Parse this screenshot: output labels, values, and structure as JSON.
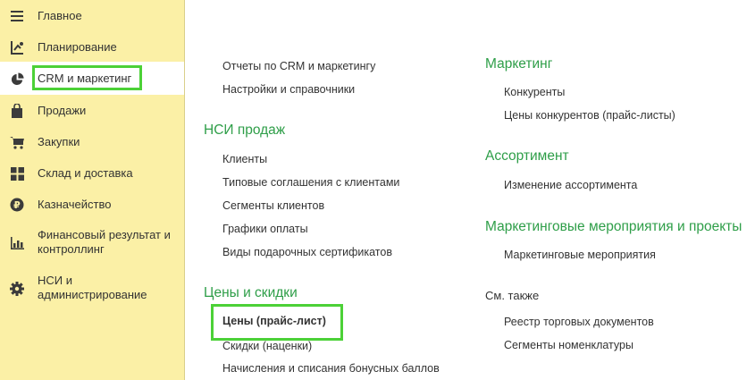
{
  "sidebar": {
    "items": [
      {
        "label": "Главное",
        "icon": "menu-icon"
      },
      {
        "label": "Планирование",
        "icon": "planning-icon"
      },
      {
        "label": "CRM и маркетинг",
        "icon": "pie-chart-icon"
      },
      {
        "label": "Продажи",
        "icon": "shopping-bag-icon"
      },
      {
        "label": "Закупки",
        "icon": "cart-icon"
      },
      {
        "label": "Склад и доставка",
        "icon": "warehouse-icon"
      },
      {
        "label": "Казначейство",
        "icon": "ruble-icon"
      },
      {
        "label": "Финансовый результат и",
        "label2": "контроллинг",
        "icon": "bar-chart-icon"
      },
      {
        "label": "НСИ и",
        "label2": "администрирование",
        "icon": "gear-icon"
      }
    ]
  },
  "left_column": {
    "top_links": [
      "Отчеты по CRM и маркетингу",
      "Настройки и справочники"
    ],
    "sections": [
      {
        "title": "НСИ продаж",
        "links": [
          "Клиенты",
          "Типовые соглашения с клиентами",
          "Сегменты клиентов",
          "Графики оплаты",
          "Виды подарочных сертификатов"
        ]
      },
      {
        "title": "Цены и скидки",
        "links": [
          "Цены (прайс-лист)",
          "Скидки (наценки)",
          "Начисления и списания бонусных баллов"
        ]
      }
    ]
  },
  "right_column": {
    "sections": [
      {
        "title": "Маркетинг",
        "links": [
          "Конкуренты",
          "Цены конкурентов (прайс-листы)"
        ]
      },
      {
        "title": "Ассортимент",
        "links": [
          "Изменение ассортимента"
        ]
      },
      {
        "title": "Маркетинговые мероприятия и проекты",
        "links": [
          "Маркетинговые мероприятия"
        ]
      }
    ],
    "see_also": {
      "title": "См. также",
      "links": [
        "Реестр торговых документов",
        "Сегменты номенклатуры"
      ]
    }
  },
  "colors": {
    "sidebar_bg": "#fbf0a6",
    "section_title": "#2e9e48",
    "highlight": "#4cd137"
  }
}
